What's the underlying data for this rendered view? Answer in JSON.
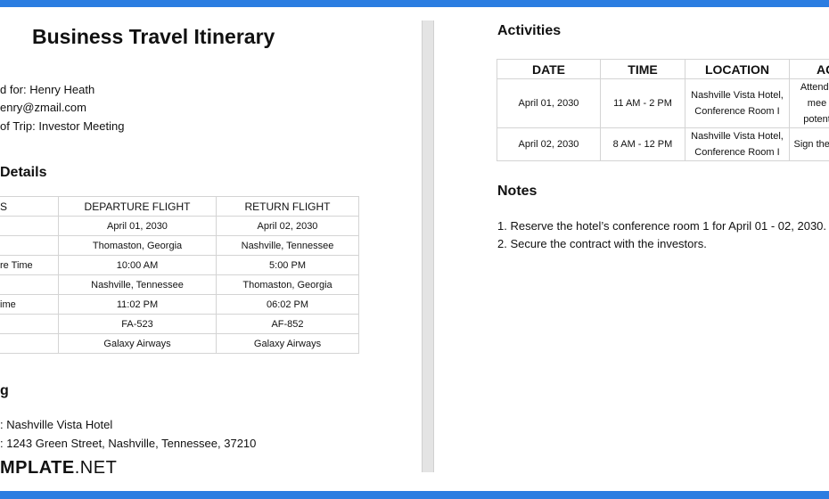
{
  "colors": {
    "accent": "#2b7de1"
  },
  "title": "Business Travel Itinerary",
  "info": [
    "d for: Henry Heath",
    "enry@zmail.com",
    "of Trip: Investor Meeting"
  ],
  "flight": {
    "heading": "Details",
    "headers": [
      "S",
      "DEPARTURE FLIGHT",
      "RETURN FLIGHT"
    ],
    "rows": [
      [
        "",
        "April 01, 2030",
        "April 02, 2030"
      ],
      [
        "",
        "Thomaston, Georgia",
        "Nashville, Tennessee"
      ],
      [
        "re Time",
        "10:00 AM",
        "5:00 PM"
      ],
      [
        "",
        "Nashville, Tennessee",
        "Thomaston, Georgia"
      ],
      [
        "ime",
        "11:02 PM",
        "06:02 PM"
      ],
      [
        "",
        "FA-523",
        "AF-852"
      ],
      [
        "",
        "Galaxy Airways",
        "Galaxy Airways"
      ]
    ]
  },
  "lodging": {
    "heading": "g",
    "lines": [
      ": Nashville Vista Hotel",
      ": 1243 Green Street, Nashville, Tennessee, 37210"
    ]
  },
  "logo": {
    "bold": "MPLATE",
    "light": ".NET"
  },
  "activities": {
    "heading": "Activities",
    "headers": [
      "DATE",
      "TIME",
      "LOCATION",
      "AC"
    ],
    "rows": [
      [
        "April 01, 2030",
        "11 AM - 2 PM",
        "Nashville Vista Hotel, Conference Room I",
        "Attend l mee potent"
      ],
      [
        "April 02, 2030",
        "8 AM - 12 PM",
        "Nashville Vista Hotel, Conference Room I",
        "Sign the in"
      ]
    ]
  },
  "notes": {
    "heading": "Notes",
    "items": [
      "1.  Reserve the hotel’s conference room 1 for April 01 - 02, 2030.",
      "2.  Secure the contract with the investors."
    ]
  }
}
